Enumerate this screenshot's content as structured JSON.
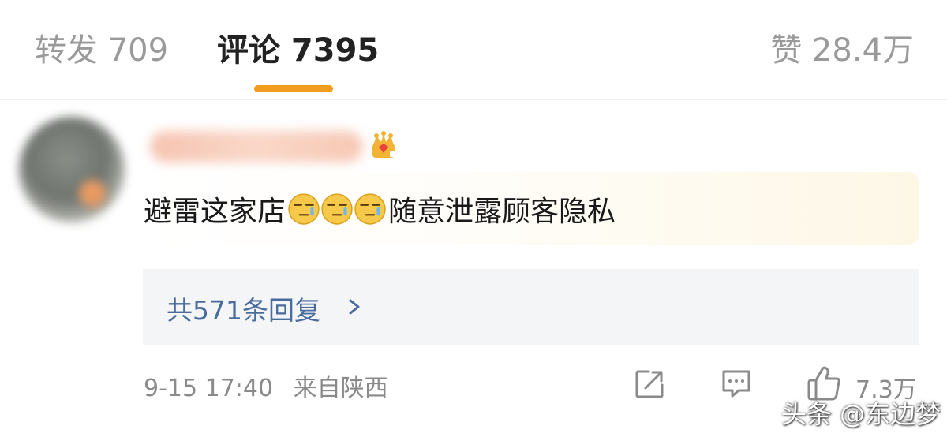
{
  "tabs": {
    "repost": "转发 709",
    "comments": "评论 7395",
    "likes": "赞 28.4万",
    "active": "comments",
    "accent_color": "#f19c1c"
  },
  "comment": {
    "user_badge_icon": "crown-icon",
    "text_before_emoji": "避雷这家店",
    "emoji_icon": "speechless-face-emoji",
    "emoji_count": 3,
    "text_after_emoji": "随意泄露顾客隐私",
    "replies_label": "共571条回复",
    "replies_icon": "chevron-right-icon",
    "timestamp": "9-15 17:40",
    "location": "来自陕西",
    "like_count": "7.3万",
    "link_color": "#4a6b9d"
  },
  "actions": {
    "share_icon": "share-icon",
    "comment_icon": "comment-icon",
    "like_icon": "thumbs-up-icon"
  },
  "watermark": "头条 @东边梦"
}
